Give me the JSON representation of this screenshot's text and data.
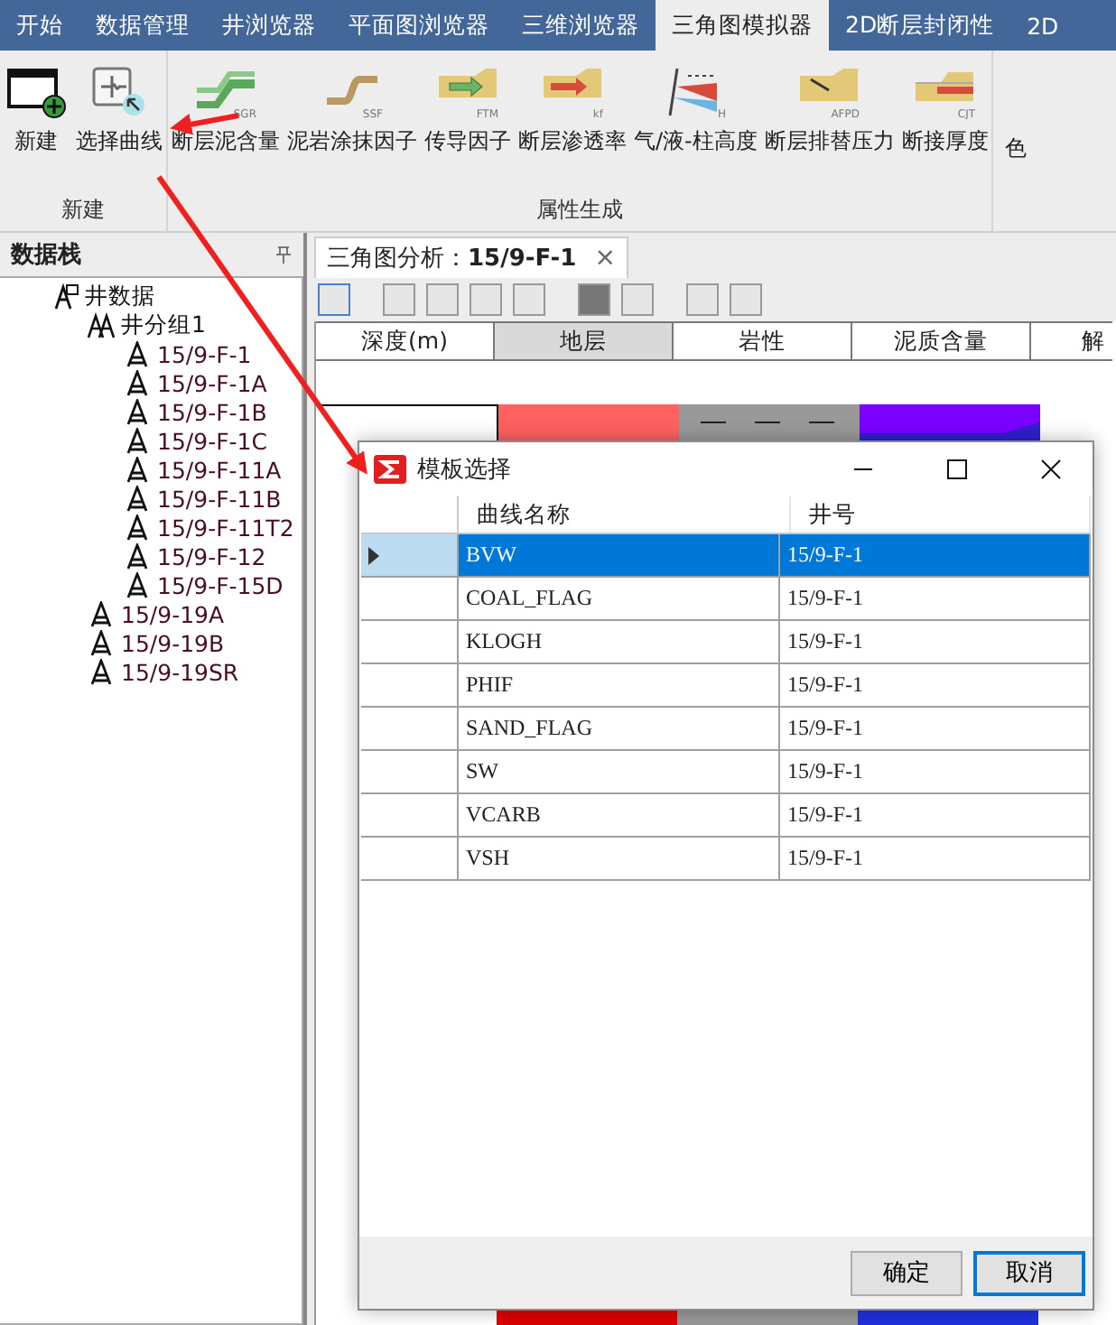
{
  "tabs": [
    {
      "label": "开始",
      "selected": false
    },
    {
      "label": "数据管理",
      "selected": false
    },
    {
      "label": "井浏览器",
      "selected": false
    },
    {
      "label": "平面图浏览器",
      "selected": false
    },
    {
      "label": "三维浏览器",
      "selected": false
    },
    {
      "label": "三角图模拟器",
      "selected": true
    },
    {
      "label": "2D断层封闭性",
      "selected": false
    },
    {
      "label": "2D",
      "selected": false
    }
  ],
  "ribbon": {
    "groups": [
      {
        "label": "新建",
        "items": [
          {
            "kind": "new",
            "label": "新建"
          },
          {
            "kind": "curve",
            "label": "选择曲线"
          }
        ]
      },
      {
        "label": "属性生成",
        "items": [
          {
            "kind": "sgr",
            "label": "断层泥含量",
            "badge": "SGR"
          },
          {
            "kind": "ssf",
            "label": "泥岩涂抹因子",
            "badge": "SSF"
          },
          {
            "kind": "ftm",
            "label": "传导因子",
            "badge": "FTM"
          },
          {
            "kind": "kf",
            "label": "断层渗透率",
            "badge": "kf"
          },
          {
            "kind": "column",
            "label": "气/液-柱高度",
            "badge": "H"
          },
          {
            "kind": "afpd",
            "label": "断层排替压力",
            "badge": "AFPD"
          },
          {
            "kind": "cjt",
            "label": "断接厚度",
            "badge": "CJT"
          }
        ]
      },
      {
        "items": [
          {
            "kind": "text",
            "label": "色"
          }
        ]
      }
    ]
  },
  "data_panel": {
    "title": "数据栈",
    "tree": [
      {
        "label": "井数据",
        "kind": "root",
        "children": [
          {
            "label": "井分组1",
            "kind": "group",
            "children": [
              {
                "label": "15/9-F-1",
                "kind": "well"
              },
              {
                "label": "15/9-F-1A",
                "kind": "well"
              },
              {
                "label": "15/9-F-1B",
                "kind": "well"
              },
              {
                "label": "15/9-F-1C",
                "kind": "well"
              },
              {
                "label": "15/9-F-11A",
                "kind": "well"
              },
              {
                "label": "15/9-F-11B",
                "kind": "well"
              },
              {
                "label": "15/9-F-11T2",
                "kind": "well"
              },
              {
                "label": "15/9-F-12",
                "kind": "well"
              },
              {
                "label": "15/9-F-15D",
                "kind": "well"
              }
            ]
          },
          {
            "label": "15/9-19A",
            "kind": "well"
          },
          {
            "label": "15/9-19B",
            "kind": "well"
          },
          {
            "label": "15/9-19SR",
            "kind": "well"
          }
        ]
      }
    ]
  },
  "document": {
    "tab": {
      "label": "三角图分析：",
      "well": "15/9-F-1",
      "close": "×"
    },
    "columns": [
      {
        "label": "深度(m)",
        "selected": false
      },
      {
        "label": "地层",
        "selected": true
      },
      {
        "label": "岩性",
        "selected": false
      },
      {
        "label": "泥质含量",
        "selected": false
      },
      {
        "label": "解",
        "selected": false
      }
    ]
  },
  "dialog": {
    "title": "模板选择",
    "columns": [
      "曲线名称",
      "井号"
    ],
    "rows": [
      {
        "curve": "BVW",
        "well": "15/9-F-1",
        "selected": true
      },
      {
        "curve": "COAL_FLAG",
        "well": "15/9-F-1",
        "selected": false
      },
      {
        "curve": "KLOGH",
        "well": "15/9-F-1",
        "selected": false
      },
      {
        "curve": "PHIF",
        "well": "15/9-F-1",
        "selected": false
      },
      {
        "curve": "SAND_FLAG",
        "well": "15/9-F-1",
        "selected": false
      },
      {
        "curve": "SW",
        "well": "15/9-F-1",
        "selected": false
      },
      {
        "curve": "VCARB",
        "well": "15/9-F-1",
        "selected": false
      },
      {
        "curve": "VSH",
        "well": "15/9-F-1",
        "selected": false
      }
    ],
    "buttons": [
      {
        "label": "确定",
        "default": false
      },
      {
        "label": "取消",
        "default": true
      }
    ]
  }
}
